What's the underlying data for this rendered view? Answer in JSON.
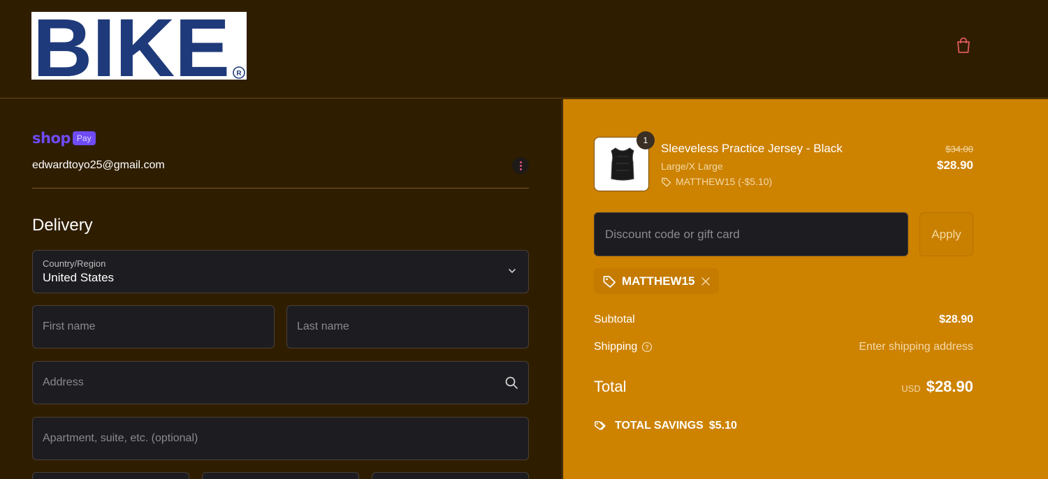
{
  "header": {
    "logo_text": "BIKE",
    "logo_registered": "®",
    "cart_icon": "shopping-bag-icon"
  },
  "account": {
    "shop_word": "shop",
    "pay_badge": "Pay",
    "email": "edwardtoyo25@gmail.com"
  },
  "delivery": {
    "title": "Delivery",
    "country_label": "Country/Region",
    "country_value": "United States",
    "first_name_placeholder": "First name",
    "last_name_placeholder": "Last name",
    "address_placeholder": "Address",
    "apartment_placeholder": "Apartment, suite, etc. (optional)"
  },
  "order": {
    "quantity": "1",
    "product_name": "Sleeveless Practice Jersey - Black",
    "variant": "Large/X Large",
    "applied_discount": "MATTHEW15 (-$5.10)",
    "original_price": "$34.00",
    "price": "$28.90",
    "discount_placeholder": "Discount code or gift card",
    "apply_label": "Apply",
    "discount_chip": "MATTHEW15",
    "subtotal_label": "Subtotal",
    "subtotal_value": "$28.90",
    "shipping_label": "Shipping",
    "shipping_value": "Enter shipping address",
    "total_label": "Total",
    "currency": "USD",
    "total_value": "$28.90",
    "savings_label": "TOTAL SAVINGS",
    "savings_value": "$5.10"
  },
  "colors": {
    "header_bg": "#2f1d00",
    "summary_bg": "#cd8200",
    "shop_purple": "#6e4bf5",
    "logo_blue": "#1f3a7a"
  }
}
